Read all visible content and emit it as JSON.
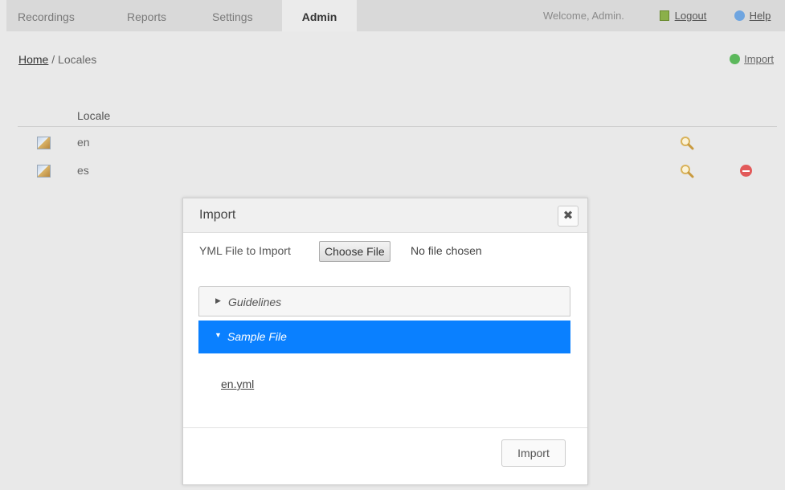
{
  "nav": {
    "tabs": [
      {
        "label": "Recordings"
      },
      {
        "label": "Reports"
      },
      {
        "label": "Settings"
      },
      {
        "label": "Admin"
      }
    ],
    "welcome": "Welcome, Admin.",
    "logout": "Logout",
    "help": "Help"
  },
  "breadcrumb": {
    "home": "Home",
    "sep": " / ",
    "current": "Locales"
  },
  "toolbar": {
    "import_label": "Import"
  },
  "table": {
    "header": "Locale",
    "rows": [
      {
        "locale": "en"
      },
      {
        "locale": "es"
      }
    ]
  },
  "modal": {
    "title": "Import",
    "close": "✖",
    "file_label": "YML File to Import",
    "choose_file": "Choose File",
    "no_file": "No file chosen",
    "accordion": [
      {
        "label": "Guidelines",
        "arrow": "▶"
      },
      {
        "label": "Sample File",
        "arrow": "▼"
      }
    ],
    "sample_link": "en.yml",
    "import_button": "Import"
  },
  "colors": {
    "accent": "#0a80ff",
    "add": "#5cb85c",
    "delete": "#e25a5a"
  }
}
